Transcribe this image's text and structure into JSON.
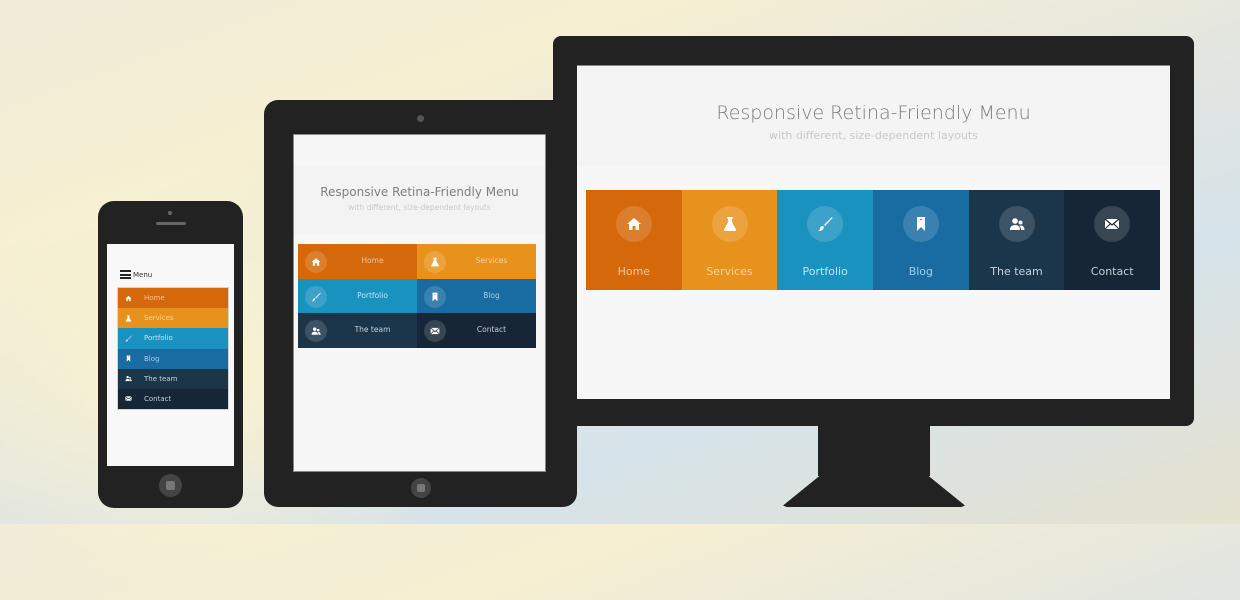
{
  "page": {
    "title": "Responsive Retina-Friendly Menu",
    "subtitle": "with different, size-dependent layouts"
  },
  "menu": {
    "toggle_label": "Menu",
    "items": [
      {
        "label": "Home",
        "icon": "home-icon",
        "color": "#d5680a",
        "text_color": "#f4c79a"
      },
      {
        "label": "Services",
        "icon": "flask-icon",
        "color": "#e8921e",
        "text_color": "#f8d39c"
      },
      {
        "label": "Portfolio",
        "icon": "brush-icon",
        "color": "#1a92c0",
        "text_color": "#c2e4f2"
      },
      {
        "label": "Blog",
        "icon": "bookmark-icon",
        "color": "#186ca2",
        "text_color": "#a8cbe4"
      },
      {
        "label": "The team",
        "icon": "team-icon",
        "color": "#1b354a",
        "text_color": "#c6d2dc"
      },
      {
        "label": "Contact",
        "icon": "envelope-icon",
        "color": "#162636",
        "text_color": "#c6ced6"
      }
    ]
  },
  "devices": {
    "desktop": "monitor",
    "tablet": "tablet",
    "mobile": "phone"
  }
}
